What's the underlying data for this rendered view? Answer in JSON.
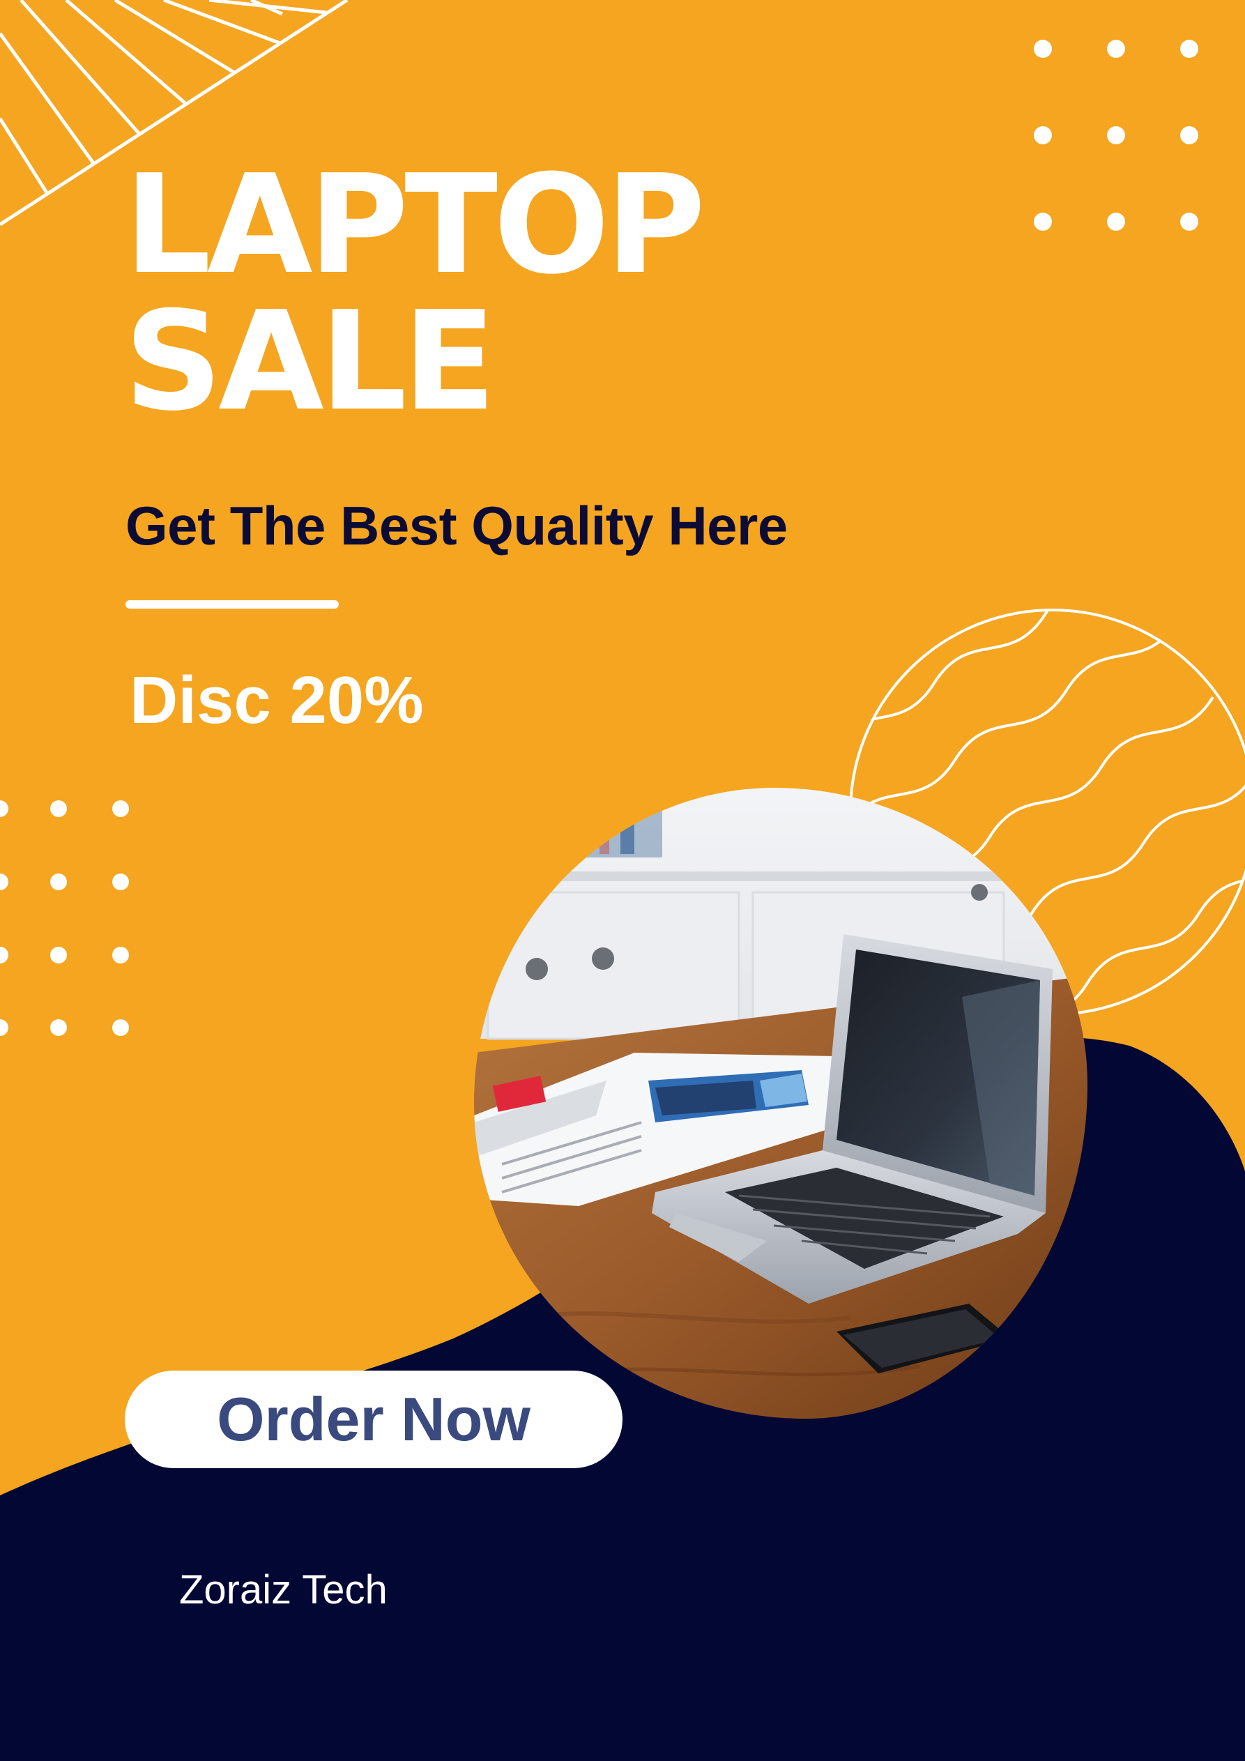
{
  "poster": {
    "title_line1": "LAPTOP",
    "title_line2": "SALE",
    "subtitle": "Get The Best Quality Here",
    "discount": "Disc 20%",
    "cta_label": "Order Now",
    "brand": "Zoraiz Tech"
  },
  "colors": {
    "background": "#F5A51F",
    "navy": "#020734",
    "white": "#FFFFFF",
    "subtitle": "#0B0B34",
    "button_text": "#3A4A7E"
  },
  "photo": {
    "subject": "laptop-on-desk-with-magazine"
  }
}
